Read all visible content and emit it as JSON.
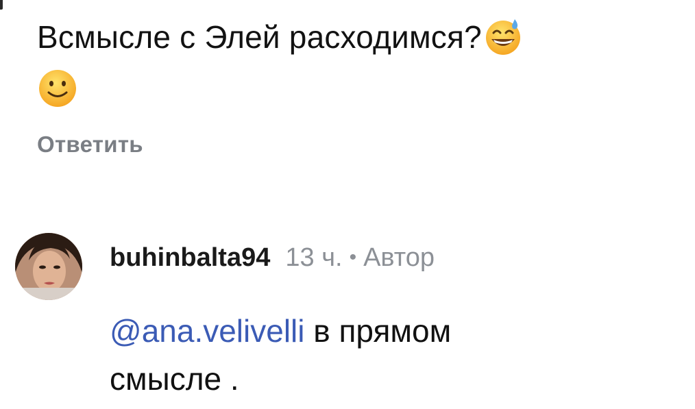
{
  "comment": {
    "text": "Всмысле с Элей расходимся?",
    "emojis": [
      "grinning-face-with-sweat",
      "slightly-smiling-face"
    ],
    "reply_label": "Ответить"
  },
  "reply": {
    "username": "buhinbalta94",
    "time": "13 ч.",
    "separator": "•",
    "author_badge": "Автор",
    "mention": "@ana.velivelli",
    "text_line1": " в прямом",
    "text_line2": "смысле ."
  },
  "colors": {
    "link": "#3b5bb5",
    "muted": "#8c9096",
    "reply_label": "#7a7e84",
    "text": "#111111"
  }
}
